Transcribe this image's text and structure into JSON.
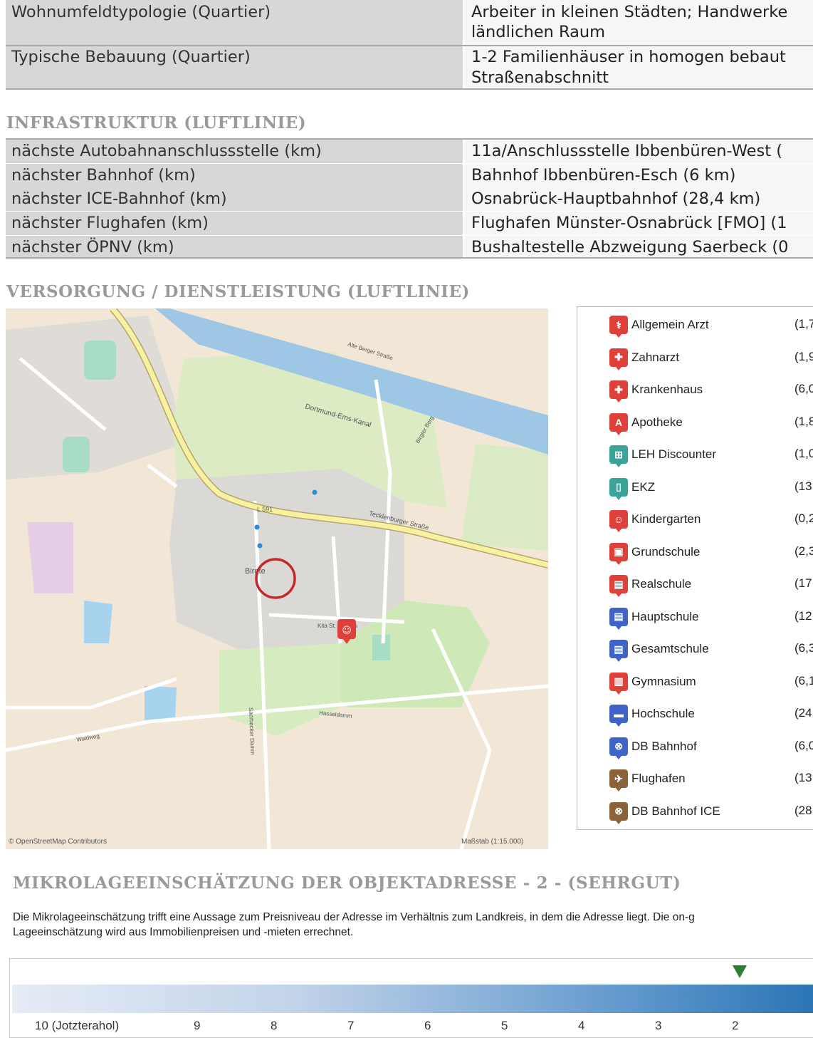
{
  "quartier": {
    "rows": [
      {
        "key": "Wohnumfeldtypologie (Quartier)",
        "value": "Arbeiter in kleinen Städten; Handwerke\nländlichen Raum"
      },
      {
        "key": "Typische Bebauung (Quartier)",
        "value": "1-2 Familienhäuser in homogen bebaut\nStraßenabschnitt"
      }
    ]
  },
  "infrastruktur": {
    "heading": "INFRASTRUKTUR (LUFTLINIE)",
    "rows": [
      {
        "key": "nächste Autobahnanschlussstelle (km)",
        "value": "11a/Anschlussstelle Ibbenbüren-West ("
      },
      {
        "key": "nächster Bahnhof (km)",
        "value": "Bahnhof Ibbenbüren-Esch (6 km)"
      },
      {
        "key": "nächster ICE-Bahnhof (km)",
        "value": "Osnabrück-Hauptbahnhof (28,4 km)"
      },
      {
        "key": "nächster Flughafen (km)",
        "value": "Flughafen Münster-Osnabrück [FMO] (1"
      },
      {
        "key": "nächster ÖPNV (km)",
        "value": "Bushaltestelle Abzweigung Saerbeck (0"
      }
    ]
  },
  "versorgung": {
    "heading": "VERSORGUNG / DIENSTLEISTUNG (LUFTLINIE)",
    "map": {
      "attribution": "© OpenStreetMap Contributors",
      "scale": "Maßstab (1:15.000)",
      "labels": {
        "place": "Birgte",
        "road_l591": "L 591",
        "canal": "Dortmund-Ems-Kanal",
        "tecklenburger": "Tecklenburger Straße",
        "kita": "Kita St. Mathias",
        "alte_berger": "Alte Berger Straße",
        "saerbecker": "Saerbecker Damm",
        "hasseldamm": "Hasseldamm",
        "waldweg": "Waldweg",
        "birgter": "Birgter Berg"
      }
    },
    "amenities": [
      {
        "label": "Allgemein Arzt",
        "dist": "(1,7",
        "color": "#e0403a",
        "glyph": "⚕"
      },
      {
        "label": "Zahnarzt",
        "dist": "(1,9",
        "color": "#e0403a",
        "glyph": "✚"
      },
      {
        "label": "Krankenhaus",
        "dist": "(6,0",
        "color": "#e0403a",
        "glyph": "✚"
      },
      {
        "label": "Apotheke",
        "dist": "(1,8",
        "color": "#e0403a",
        "glyph": "A"
      },
      {
        "label": "LEH Discounter",
        "dist": "(1,0",
        "color": "#3aa39a",
        "glyph": "⊞"
      },
      {
        "label": "EKZ",
        "dist": "(13",
        "color": "#3aa39a",
        "glyph": "▯"
      },
      {
        "label": "Kindergarten",
        "dist": "(0,2",
        "color": "#e0403a",
        "glyph": "☺"
      },
      {
        "label": "Grundschule",
        "dist": "(2,3",
        "color": "#e0403a",
        "glyph": "▣"
      },
      {
        "label": "Realschule",
        "dist": "(17",
        "color": "#e0403a",
        "glyph": "▤"
      },
      {
        "label": "Hauptschule",
        "dist": "(12",
        "color": "#3f63c6",
        "glyph": "▤"
      },
      {
        "label": "Gesamtschule",
        "dist": "(6,3",
        "color": "#3f63c6",
        "glyph": "▤"
      },
      {
        "label": "Gymnasium",
        "dist": "(6,1",
        "color": "#e0403a",
        "glyph": "▥"
      },
      {
        "label": "Hochschule",
        "dist": "(24",
        "color": "#3f63c6",
        "glyph": "▬"
      },
      {
        "label": "DB Bahnhof",
        "dist": "(6,0",
        "color": "#3f63c6",
        "glyph": "⊗"
      },
      {
        "label": "Flughafen",
        "dist": "(13",
        "color": "#8c6239",
        "glyph": "✈"
      },
      {
        "label": "DB Bahnhof ICE",
        "dist": "(28",
        "color": "#8c6239",
        "glyph": "⊗"
      }
    ]
  },
  "mikrolage": {
    "heading": "MIKROLAGEEINSCHÄTZUNG DER OBJEKTADRESSE - 2 - (SEHRGUT)",
    "text_line1": "Die Mikrolageeinschätzung trifft eine Aussage zum Preisniveau der Adresse im Verhältnis zum Landkreis, in dem die Adresse liegt. Die on-g",
    "text_line2": "Lageeinschätzung wird aus Immobilienpreisen und -mieten errechnet.",
    "score": 2,
    "marker_color": "#2e7d32",
    "scale_ticks": [
      "10 (Jotzterahol)",
      "9",
      "8",
      "7",
      "6",
      "5",
      "4",
      "3",
      "2"
    ]
  }
}
